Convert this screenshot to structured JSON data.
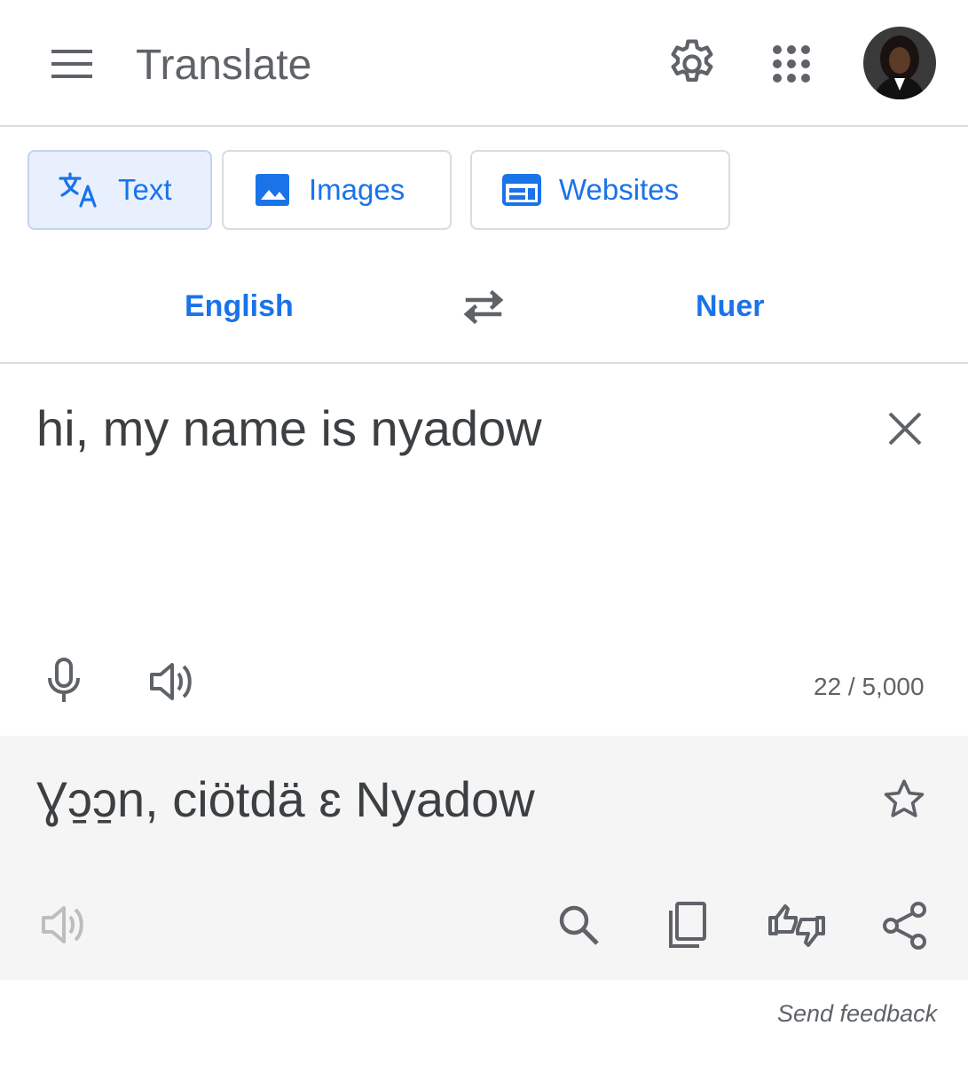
{
  "header": {
    "title": "Translate",
    "icons": [
      "menu-icon",
      "settings-icon",
      "apps-grid-icon",
      "avatar"
    ]
  },
  "modes": {
    "text": "Text",
    "images": "Images",
    "websites": "Websites",
    "selected": "Text"
  },
  "languages": {
    "source": "English",
    "target": "Nuer"
  },
  "source": {
    "text": "hi, my name is nyadow",
    "char_count": "22 / 5,000"
  },
  "result": {
    "text": "Ɣɔ̱ɔ̱n, ciötdä ɛ Nyadow"
  },
  "footer": {
    "feedback": "Send feedback"
  },
  "colors": {
    "accent": "#1a73e8",
    "icon": "#5f6368",
    "text": "#3c4043",
    "divider": "#dadce0",
    "selected_tab_bg": "#e8f0fe",
    "result_bg": "#f5f5f5"
  }
}
